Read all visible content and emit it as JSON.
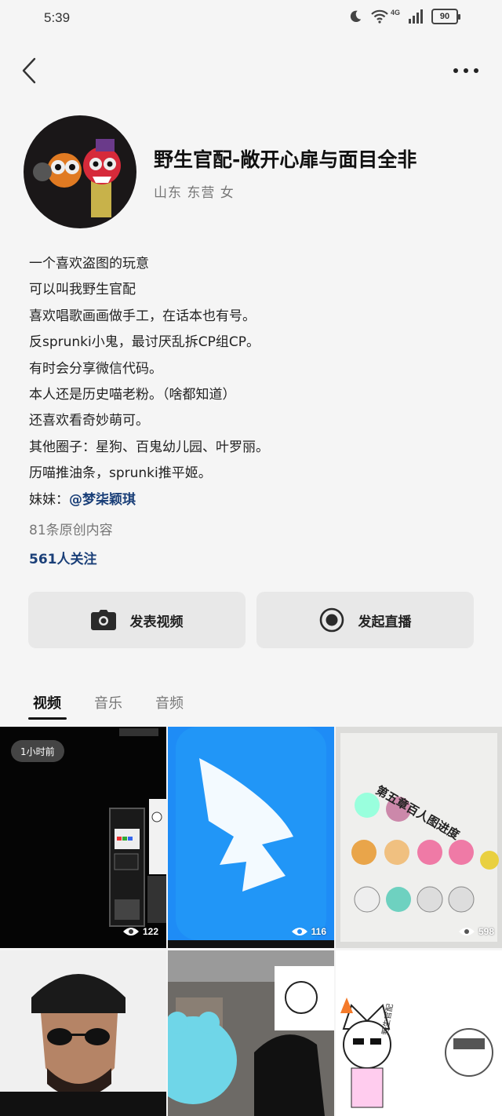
{
  "status": {
    "time": "5:39",
    "network": "4G",
    "battery": "90"
  },
  "profile": {
    "name": "野生官配-敞开心扉与面目全非",
    "meta": "山东 东营 女"
  },
  "bio": {
    "lines": [
      "一个喜欢盗图的玩意",
      "可以叫我野生官配",
      "喜欢唱歌画画做手工，在话本也有号。",
      "反sprunki小鬼，最讨厌乱拆CP组CP。",
      "有时会分享微信代码。",
      "本人还是历史喵老粉。（啥都知道）",
      "还喜欢看奇妙萌可。",
      "其他圈子：星狗、百鬼幼儿园、叶罗丽。",
      "历喵推油条，sprunki推平姬。"
    ],
    "sister_label": "妹妹：",
    "sister_link": "@梦柒颖琪"
  },
  "stats": {
    "works": "81条原创内容",
    "followers": "561人关注"
  },
  "actions": {
    "post_video": "发表视频",
    "start_live": "发起直播"
  },
  "tabs": [
    "视频",
    "音乐",
    "音频"
  ],
  "grid": {
    "time_badge": "1小时前",
    "views": [
      "122",
      "116",
      "598"
    ],
    "video_labels": [
      "第五章百人图进度",
      "野生官配"
    ]
  },
  "colors": {
    "accent_link": "#1a3f78",
    "app_icon_blue": "#1f8ff7"
  }
}
